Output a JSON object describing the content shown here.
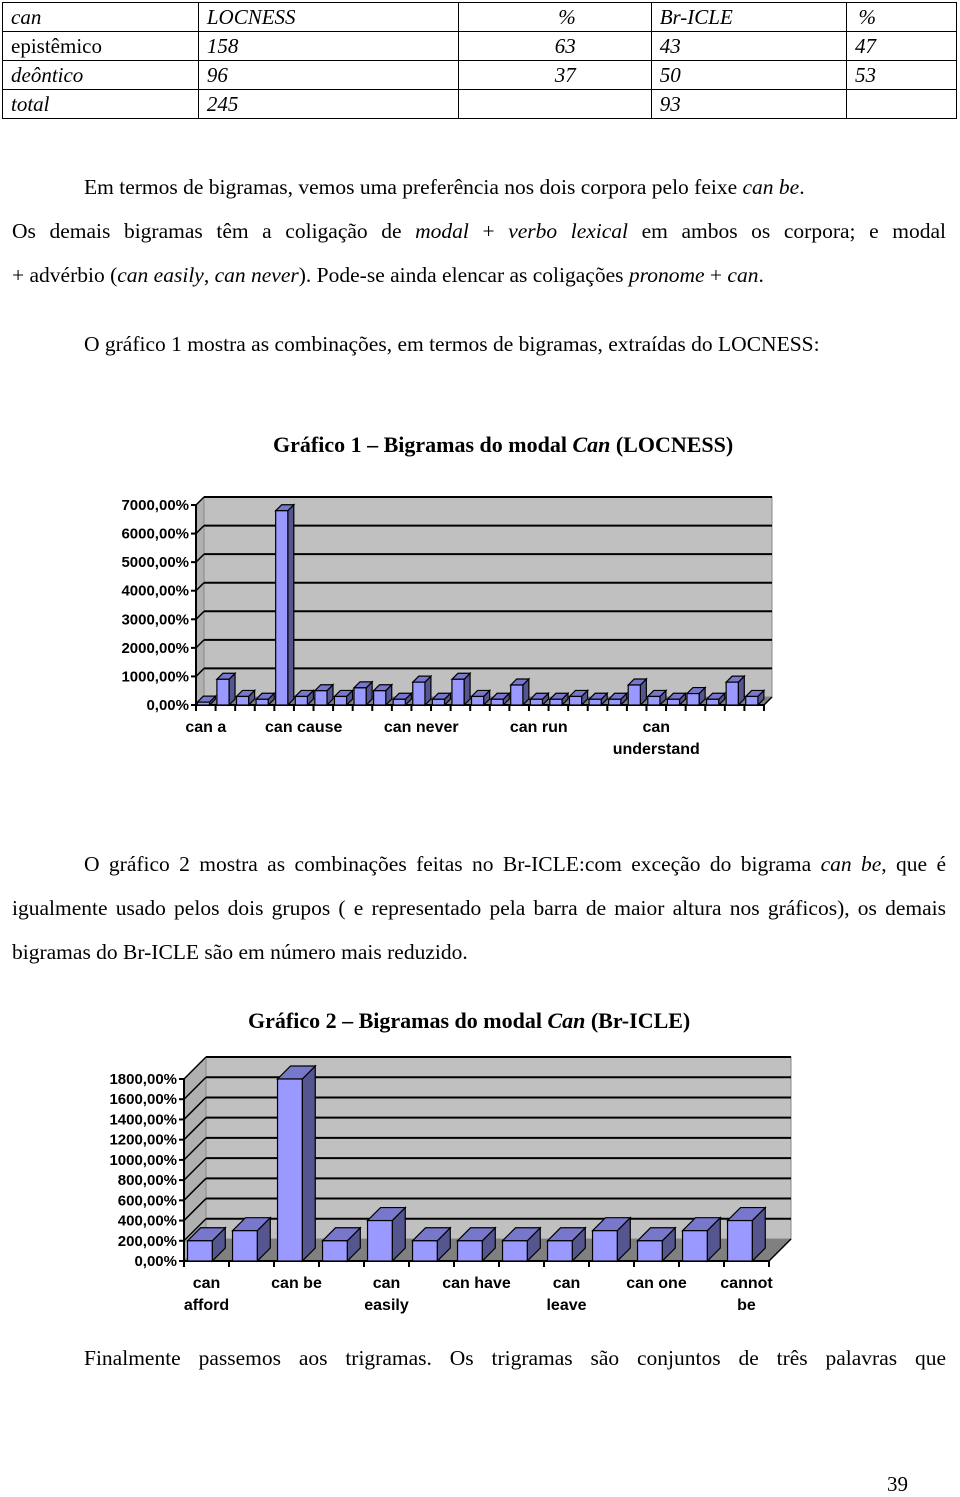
{
  "table": {
    "header": [
      "can",
      "LOCNESS",
      "%",
      "Br-ICLE",
      "%"
    ],
    "rows": [
      [
        "epistêmico",
        "158",
        "63",
        "43",
        "47"
      ],
      [
        "deôntico",
        "96",
        "37",
        "50",
        "53"
      ],
      [
        "total",
        "245",
        "",
        "93",
        ""
      ]
    ]
  },
  "paragraph1": {
    "line1_a": "Em termos de bigramas, vemos uma preferência nos dois corpora pelo feixe ",
    "line1_em": "can be",
    "line1_b": ".",
    "line2_a": "Os demais bigramas têm a coligação de ",
    "line2_em1": "modal",
    "line2_b": " + ",
    "line2_em2": "verbo lexical",
    "line2_c": " em ambos os corpora; e modal",
    "line3_a": "+ advérbio (",
    "line3_em1": "can easily",
    "line3_b": ", ",
    "line3_em2": "can never",
    "line3_c": "). Pode-se ainda elencar as coligações ",
    "line3_em3": "pronome",
    "line3_d": " + ",
    "line3_em4": "can",
    "line3_e": "."
  },
  "paragraph2": "O gráfico 1 mostra as combinações, em termos de bigramas, extraídas do LOCNESS:",
  "paragraph3": {
    "a": "O gráfico 2 mostra as combinações feitas no Br-ICLE:com exceção do bigrama ",
    "em1": "can be",
    "b": ", que é igualmente usado pelos dois grupos ( e representado pela barra de maior altura nos gráficos), os demais bigramas do Br-ICLE são em número mais reduzido."
  },
  "paragraph4": "Finalmente passemos aos trigramas. Os trigramas são conjuntos de três palavras que",
  "page_number": "39",
  "colors": {
    "bar_front": "#9999ff",
    "bar_side": "#55558f",
    "bar_top": "#7777cc",
    "plot_bg": "#c0c0c0",
    "floor": "#808080"
  },
  "chart_data": [
    {
      "type": "bar",
      "title_a": "Gráfico 1 – Bigramas do  modal ",
      "title_em": "Can",
      "title_b": " (LOCNESS)",
      "xlabel": "",
      "ylabel": "",
      "ylim": [
        0,
        7000
      ],
      "yticks": [
        "0,00%",
        "1000,00%",
        "2000,00%",
        "3000,00%",
        "4000,00%",
        "5000,00%",
        "6000,00%",
        "7000,00%"
      ],
      "grid": true,
      "legend": "none",
      "visible_category_labels": [
        {
          "index": 0,
          "label": [
            "can a"
          ]
        },
        {
          "index": 5,
          "label": [
            "can cause"
          ]
        },
        {
          "index": 11,
          "label": [
            "can never"
          ]
        },
        {
          "index": 17,
          "label": [
            "can run"
          ]
        },
        {
          "index": 23,
          "label": [
            "can",
            "understand"
          ]
        }
      ],
      "values": [
        100,
        900,
        300,
        200,
        6800,
        300,
        500,
        300,
        600,
        500,
        200,
        800,
        200,
        900,
        300,
        200,
        700,
        200,
        200,
        300,
        200,
        200,
        700,
        300,
        200,
        400,
        200,
        800,
        300
      ]
    },
    {
      "type": "bar",
      "title_a": "Gráfico 2 – Bigramas do modal ",
      "title_em": "Can",
      "title_b": " (Br-ICLE)",
      "xlabel": "",
      "ylabel": "",
      "ylim": [
        0,
        1800
      ],
      "yticks": [
        "0,00%",
        "200,00%",
        "400,00%",
        "600,00%",
        "800,00%",
        "1000,00%",
        "1200,00%",
        "1400,00%",
        "1600,00%",
        "1800,00%"
      ],
      "grid": true,
      "legend": "none",
      "visible_category_labels": [
        {
          "index": 0,
          "label": [
            "can",
            "afford"
          ]
        },
        {
          "index": 2,
          "label": [
            "can be"
          ]
        },
        {
          "index": 4,
          "label": [
            "can",
            "easily"
          ]
        },
        {
          "index": 6,
          "label": [
            "can have"
          ]
        },
        {
          "index": 8,
          "label": [
            "can",
            "leave"
          ]
        },
        {
          "index": 10,
          "label": [
            "can one"
          ]
        },
        {
          "index": 12,
          "label": [
            "cannot",
            "be"
          ]
        }
      ],
      "values": [
        200,
        300,
        1800,
        200,
        400,
        200,
        200,
        200,
        200,
        300,
        200,
        300,
        400
      ]
    }
  ]
}
